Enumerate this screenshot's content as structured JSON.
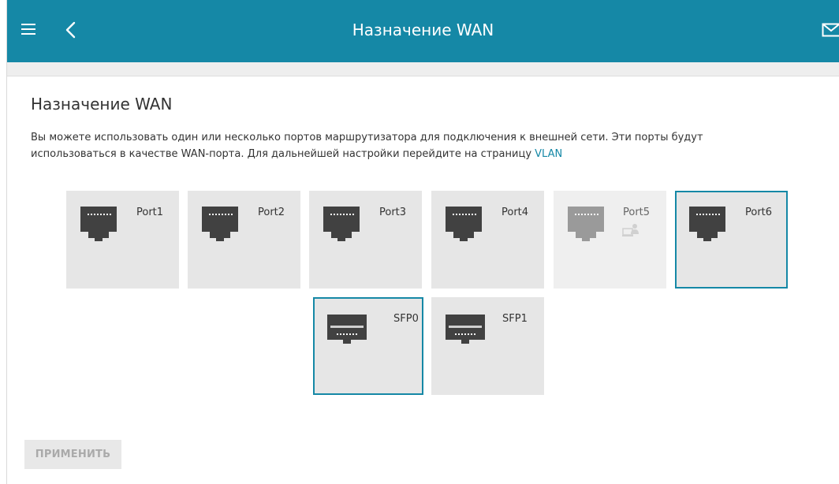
{
  "header": {
    "title": "Назначение WAN"
  },
  "page": {
    "title": "Назначение WAN",
    "description_prefix": "Вы можете использовать один или несколько портов маршрутизатора для подключения к внешней сети. Эти порты будут использоваться в качестве WAN-порта. Для дальнейшей настройки перейдите на страницу ",
    "description_link": "VLAN"
  },
  "ports": [
    {
      "label": "Port1",
      "type": "ethernet",
      "state": "normal"
    },
    {
      "label": "Port2",
      "type": "ethernet",
      "state": "normal"
    },
    {
      "label": "Port3",
      "type": "ethernet",
      "state": "normal"
    },
    {
      "label": "Port4",
      "type": "ethernet",
      "state": "normal"
    },
    {
      "label": "Port5",
      "type": "ethernet",
      "state": "disabled",
      "secondary_icon": "computer-user-icon"
    },
    {
      "label": "Port6",
      "type": "ethernet",
      "state": "selected"
    },
    {
      "label": "SFP0",
      "type": "sfp",
      "state": "selected"
    },
    {
      "label": "SFP1",
      "type": "sfp",
      "state": "normal"
    }
  ],
  "actions": {
    "apply_label": "ПРИМЕНИТЬ"
  },
  "colors": {
    "header_bg": "#1588a6",
    "selected_border": "#1588a6",
    "card_bg": "#e6e6e6",
    "card_disabled_bg": "#efefef",
    "link": "#1588a6"
  }
}
